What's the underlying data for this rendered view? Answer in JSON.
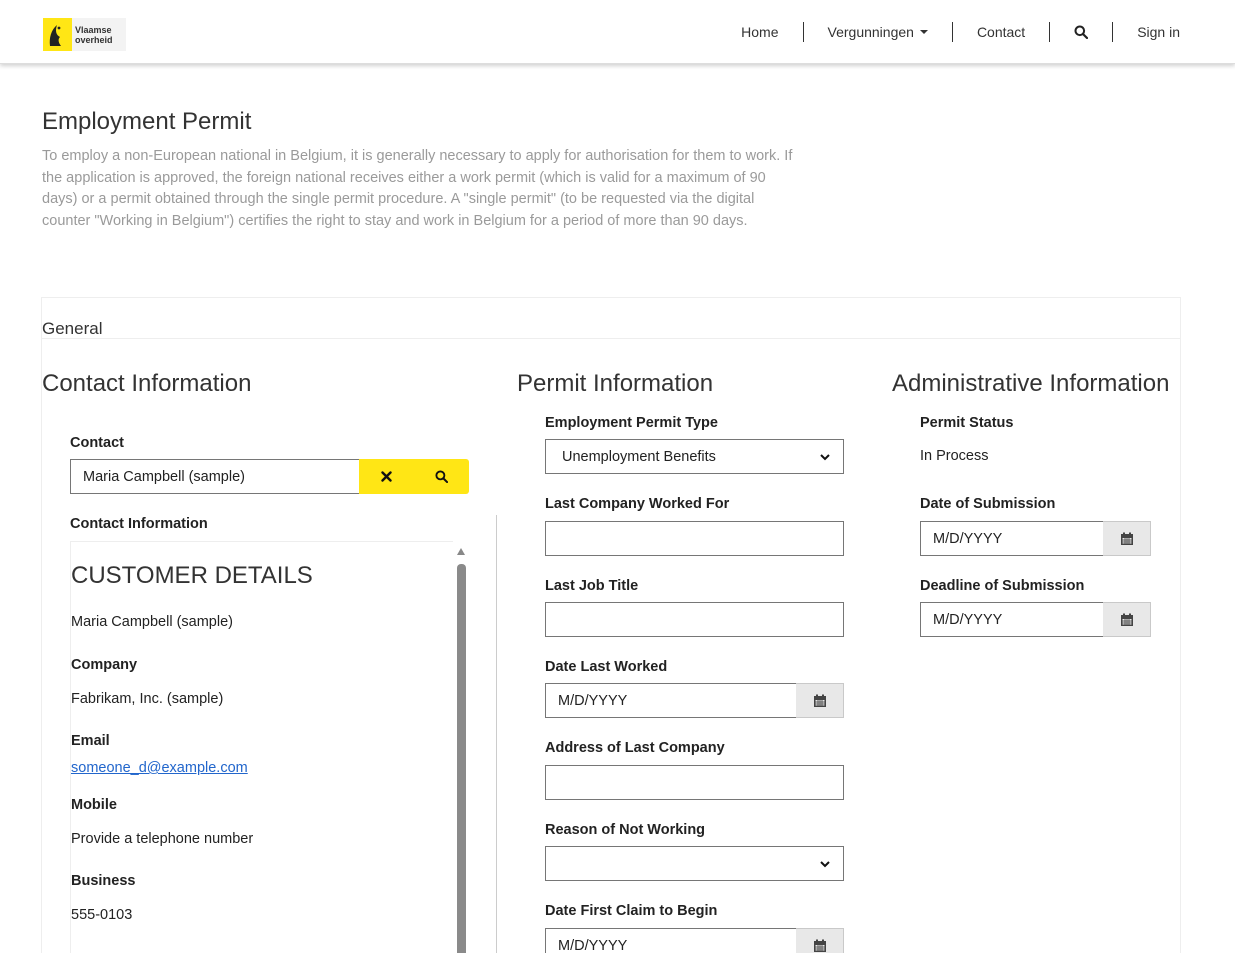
{
  "brand": {
    "line1": "Vlaamse",
    "line2": "overheid"
  },
  "nav": {
    "home": "Home",
    "permits": "Vergunningen",
    "contact": "Contact",
    "signin": "Sign in"
  },
  "page": {
    "title": "Employment Permit",
    "description": "To employ a non-European national in Belgium, it is generally necessary to apply for authorisation for them to work. If the application is approved, the foreign national receives either a work permit (which is valid for a maximum of 90 days) or a permit obtained through the single permit procedure. A \"single permit\" (to be requested via the digital counter \"Working in Belgium\") certifies the right to stay and work in Belgium for a period of more than 90 days."
  },
  "section": {
    "title": "General"
  },
  "contact_col": {
    "title": "Contact Information",
    "contact_label": "Contact",
    "contact_value": "Maria Campbell (sample)",
    "info_label": "Contact Information",
    "details": {
      "heading": "CUSTOMER DETAILS",
      "name": "Maria Campbell (sample)",
      "company_label": "Company",
      "company": "Fabrikam, Inc. (sample)",
      "email_label": "Email",
      "email": "someone_d@example.com",
      "mobile_label": "Mobile",
      "mobile": "Provide a telephone number",
      "business_label": "Business",
      "business": "555-0103"
    }
  },
  "permit_col": {
    "title": "Permit Information",
    "type_label": "Employment Permit Type",
    "type_value": "Unemployment Benefits",
    "last_company_label": "Last Company Worked For",
    "last_job_label": "Last Job Title",
    "date_last_label": "Date Last Worked",
    "date_placeholder": "M/D/YYYY",
    "address_label": "Address of Last Company",
    "reason_label": "Reason of Not Working",
    "first_claim_label": "Date First Claim to Begin"
  },
  "admin_col": {
    "title": "Administrative Information",
    "status_label": "Permit Status",
    "status_value": "In Process",
    "submission_label": "Date of Submission",
    "deadline_label": "Deadline of Submission",
    "date_placeholder": "M/D/YYYY"
  },
  "colors": {
    "accent": "#ffe615",
    "link": "#2266cc"
  }
}
